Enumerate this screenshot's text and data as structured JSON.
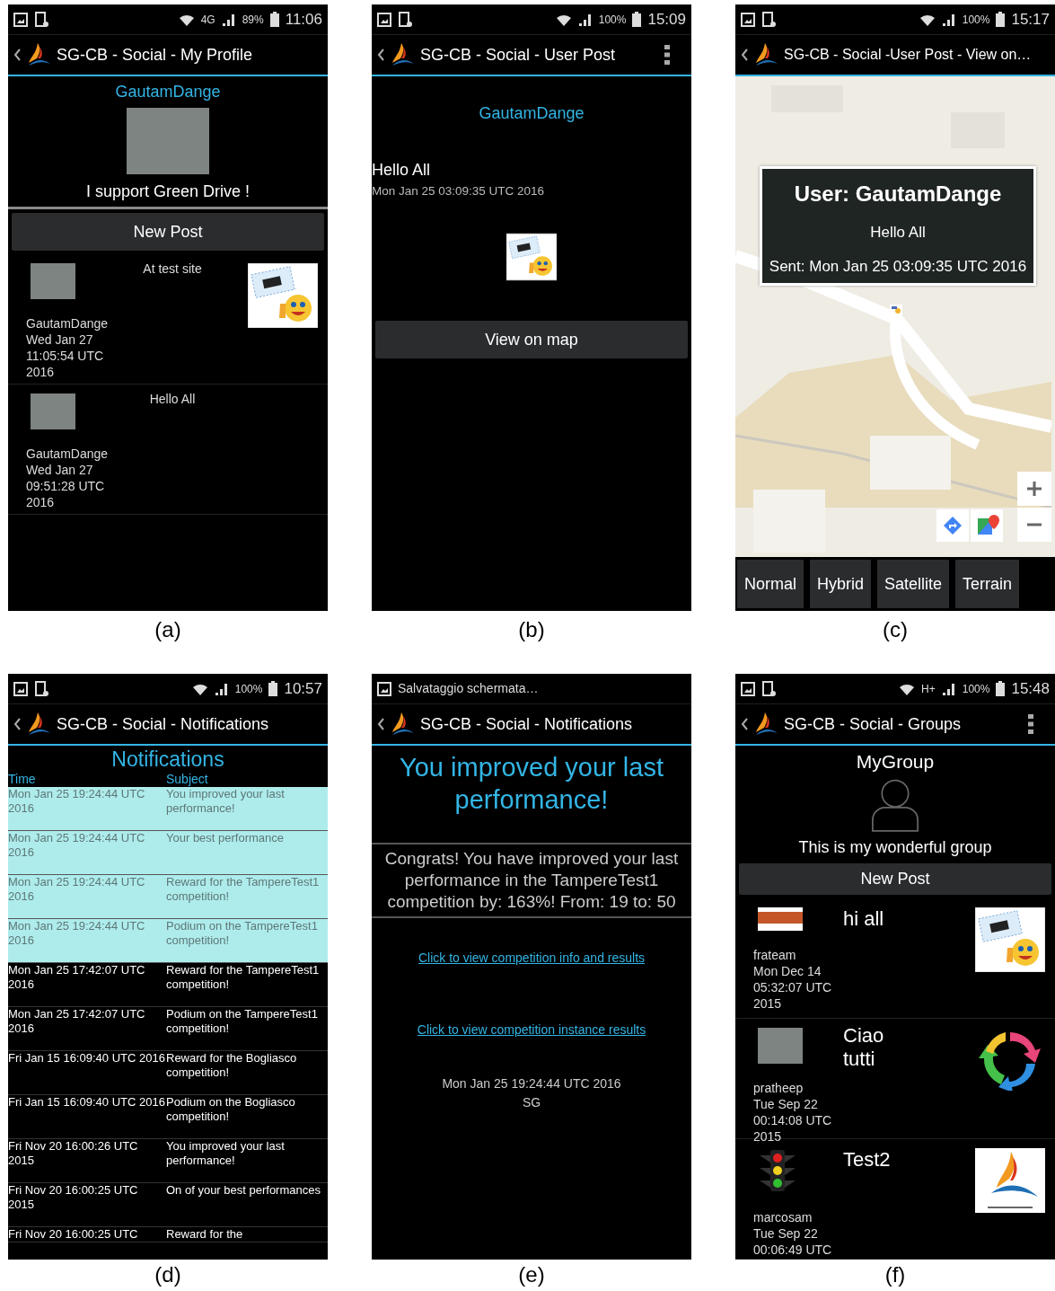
{
  "figures": [
    {
      "kind": "profile",
      "caption": "(a)",
      "status_bar": {
        "network": "4G",
        "battery": "89%",
        "time": "11:06"
      },
      "app_bar": {
        "title": "SG-CB - Social - My Profile",
        "menu": false
      },
      "username": "GautamDange",
      "status_text": "I support Green Drive !",
      "button": "New Post",
      "posts": [
        {
          "author": "GautamDange",
          "date": "Wed Jan 27 11:05:54 UTC 2016",
          "text": "At test site",
          "has_image": true
        },
        {
          "author": "GautamDange",
          "date": "Wed Jan 27 09:51:28 UTC 2016",
          "text": "Hello All",
          "has_image": false
        }
      ]
    },
    {
      "kind": "post",
      "caption": "(b)",
      "status_bar": {
        "battery": "100%",
        "time": "15:09"
      },
      "app_bar": {
        "title": "SG-CB - Social - User Post",
        "menu": true
      },
      "username": "GautamDange",
      "message": "Hello All",
      "date": "Mon Jan 25 03:09:35 UTC 2016",
      "button": "View on map"
    },
    {
      "kind": "map",
      "caption": "(c)",
      "status_bar": {
        "battery": "100%",
        "time": "15:17"
      },
      "app_bar": {
        "title": "SG-CB - Social -User Post - View on…",
        "menu": false
      },
      "info_window": {
        "title": "User: GautamDange",
        "message": "Hello All",
        "sent": "Sent: Mon Jan 25 03:09:35 UTC 2016"
      },
      "map_types": [
        "Normal",
        "Hybrid",
        "Satellite",
        "Terrain"
      ]
    },
    {
      "kind": "notifications",
      "caption": "(d)",
      "status_bar": {
        "battery": "100%",
        "time": "10:57"
      },
      "app_bar": {
        "title": "SG-CB - Social - Notifications",
        "menu": false
      },
      "heading": "Notifications",
      "columns": [
        "Time",
        "Subject"
      ],
      "rows": [
        {
          "time": "Mon Jan 25 19:24:44 UTC 2016",
          "subject": "You improved your last performance!",
          "highlighted": true
        },
        {
          "time": "Mon Jan 25 19:24:44 UTC 2016",
          "subject": "Your best performance",
          "highlighted": true
        },
        {
          "time": "Mon Jan 25 19:24:44 UTC 2016",
          "subject": "Reward for the TampereTest1 competition!",
          "highlighted": true
        },
        {
          "time": "Mon Jan 25 19:24:44 UTC 2016",
          "subject": "Podium on the TampereTest1 competition!",
          "highlighted": true
        },
        {
          "time": "Mon Jan 25 17:42:07 UTC 2016",
          "subject": "Reward for the TampereTest1 competition!",
          "highlighted": false
        },
        {
          "time": "Mon Jan 25 17:42:07 UTC 2016",
          "subject": "Podium on the TampereTest1 competition!",
          "highlighted": false
        },
        {
          "time": "Fri Jan 15 16:09:40 UTC 2016",
          "subject": "Reward for the Bogliasco competition!",
          "highlighted": false
        },
        {
          "time": "Fri Jan 15 16:09:40 UTC 2016",
          "subject": "Podium on the Bogliasco competition!",
          "highlighted": false
        },
        {
          "time": "Fri Nov 20 16:00:26 UTC 2015",
          "subject": "You improved your last performance!",
          "highlighted": false
        },
        {
          "time": "Fri Nov 20 16:00:25 UTC 2015",
          "subject": "On of your best performances",
          "highlighted": false
        },
        {
          "time": "Fri Nov 20 16:00:25 UTC",
          "subject": "Reward for the",
          "highlighted": false
        }
      ]
    },
    {
      "kind": "notification_detail",
      "caption": "(e)",
      "status_bar": {
        "notification": "Salvataggio schermata…"
      },
      "app_bar": {
        "title": "SG-CB - Social - Notifications",
        "menu": false
      },
      "title": "You improved your last performance!",
      "body": "Congrats! You have improved your last performance in the TampereTest1 competition by: 163%! From: 19 to: 50",
      "links": [
        "Click to view competition info and results",
        "Click to view competition instance results"
      ],
      "date": "Mon Jan 25 19:24:44 UTC 2016",
      "sender": "SG"
    },
    {
      "kind": "group",
      "caption": "(f)",
      "status_bar": {
        "network": "H+",
        "battery": "100%",
        "time": "15:48"
      },
      "app_bar": {
        "title": "SG-CB - Social - Groups",
        "menu": true
      },
      "name": "MyGroup",
      "description": "This is my wonderful group",
      "button": "New Post",
      "posts": [
        {
          "author": "frateam",
          "date": "Mon Dec 14 05:32:07 UTC 2015",
          "text": "hi all",
          "avatar": {
            "kind": "logo"
          },
          "image": {
            "kind": "sticker"
          }
        },
        {
          "author": "pratheep",
          "date": "Tue Sep 22 00:14:08 UTC 2015",
          "text": "Ciao tutti",
          "avatar": {
            "kind": "photo"
          },
          "image": {
            "kind": "arrows"
          }
        },
        {
          "author": "marcosam",
          "date": "Tue Sep 22 00:06:49 UTC",
          "text": "Test2",
          "avatar": {
            "kind": "traffic-light"
          },
          "image": {
            "kind": "logo"
          }
        }
      ]
    }
  ]
}
